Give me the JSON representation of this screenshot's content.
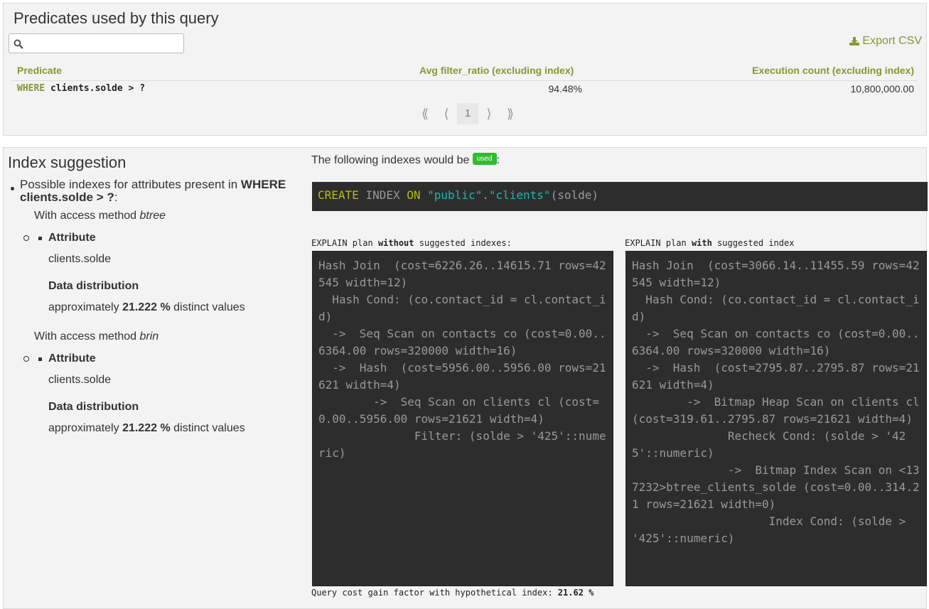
{
  "predicates": {
    "title": "Predicates used by this query",
    "search": {
      "value": "",
      "placeholder": ""
    },
    "export_label": "Export CSV",
    "columns": [
      "Predicate",
      "Avg filter_ratio (excluding index)",
      "Execution count (excluding index)"
    ],
    "rows": [
      {
        "keyword": "WHERE",
        "expr": "clients.solde > ?",
        "filter_ratio": "94.48%",
        "exec_count": "10,800,000.00"
      }
    ],
    "pagination": {
      "first": "⟪",
      "prev": "⟨",
      "page": "1",
      "next": "⟩",
      "last": "⟫"
    }
  },
  "index_suggestion": {
    "title": "Index suggestion",
    "intro_text": "Possible indexes for attributes present in",
    "intro_bold": "WHERE clients.solde > ?",
    "intro_suffix": ":",
    "methods": [
      {
        "prefix": "With access method",
        "method": "btree",
        "attr_label": "Attribute",
        "attr_value": "clients.solde",
        "dist_label": "Data distribution",
        "dist_pre": "approximately",
        "dist_value": "21.222 %",
        "dist_post": "distinct values"
      },
      {
        "prefix": "With access method",
        "method": "brin",
        "attr_label": "Attribute",
        "attr_value": "clients.solde",
        "dist_label": "Data distribution",
        "dist_pre": "approximately",
        "dist_value": "21.222 %",
        "dist_post": "distinct values"
      }
    ],
    "used_text_pre": "The following indexes would be",
    "used_badge": "used",
    "used_text_post": ":",
    "create_stmt": {
      "kw_create": "CREATE",
      "kw_index": "INDEX",
      "kw_on": "ON",
      "schema": "\"public\"",
      "dot": ".",
      "table": "\"clients\"",
      "cols": "(solde)"
    },
    "without_caption": {
      "pre": "EXPLAIN plan",
      "bold": "without",
      "post": "suggested indexes:"
    },
    "with_caption": {
      "pre": "EXPLAIN plan",
      "bold": "with",
      "post": "suggested index"
    },
    "plan_without": "Hash Join  (cost=6226.26..14615.71 rows=42545 width=12)\n  Hash Cond: (co.contact_id = cl.contact_id)\n  ->  Seq Scan on contacts co (cost=0.00..6364.00 rows=320000 width=16)\n  ->  Hash  (cost=5956.00..5956.00 rows=21621 width=4)\n        ->  Seq Scan on clients cl (cost=0.00..5956.00 rows=21621 width=4)\n              Filter: (solde > '425'::numeric)",
    "plan_with": "Hash Join  (cost=3066.14..11455.59 rows=42545 width=12)\n  Hash Cond: (co.contact_id = cl.contact_id)\n  ->  Seq Scan on contacts co (cost=0.00..6364.00 rows=320000 width=16)\n  ->  Hash  (cost=2795.87..2795.87 rows=21621 width=4)\n        ->  Bitmap Heap Scan on clients cl  (cost=319.61..2795.87 rows=21621 width=4)\n              Recheck Cond: (solde > '425'::numeric)\n              ->  Bitmap Index Scan on <137232>btree_clients_solde (cost=0.00..314.21 rows=21621 width=0)\n                    Index Cond: (solde > '425'::numeric)",
    "gain_text": "Query cost gain factor with hypothetical index:",
    "gain_value": "21.62 %"
  }
}
